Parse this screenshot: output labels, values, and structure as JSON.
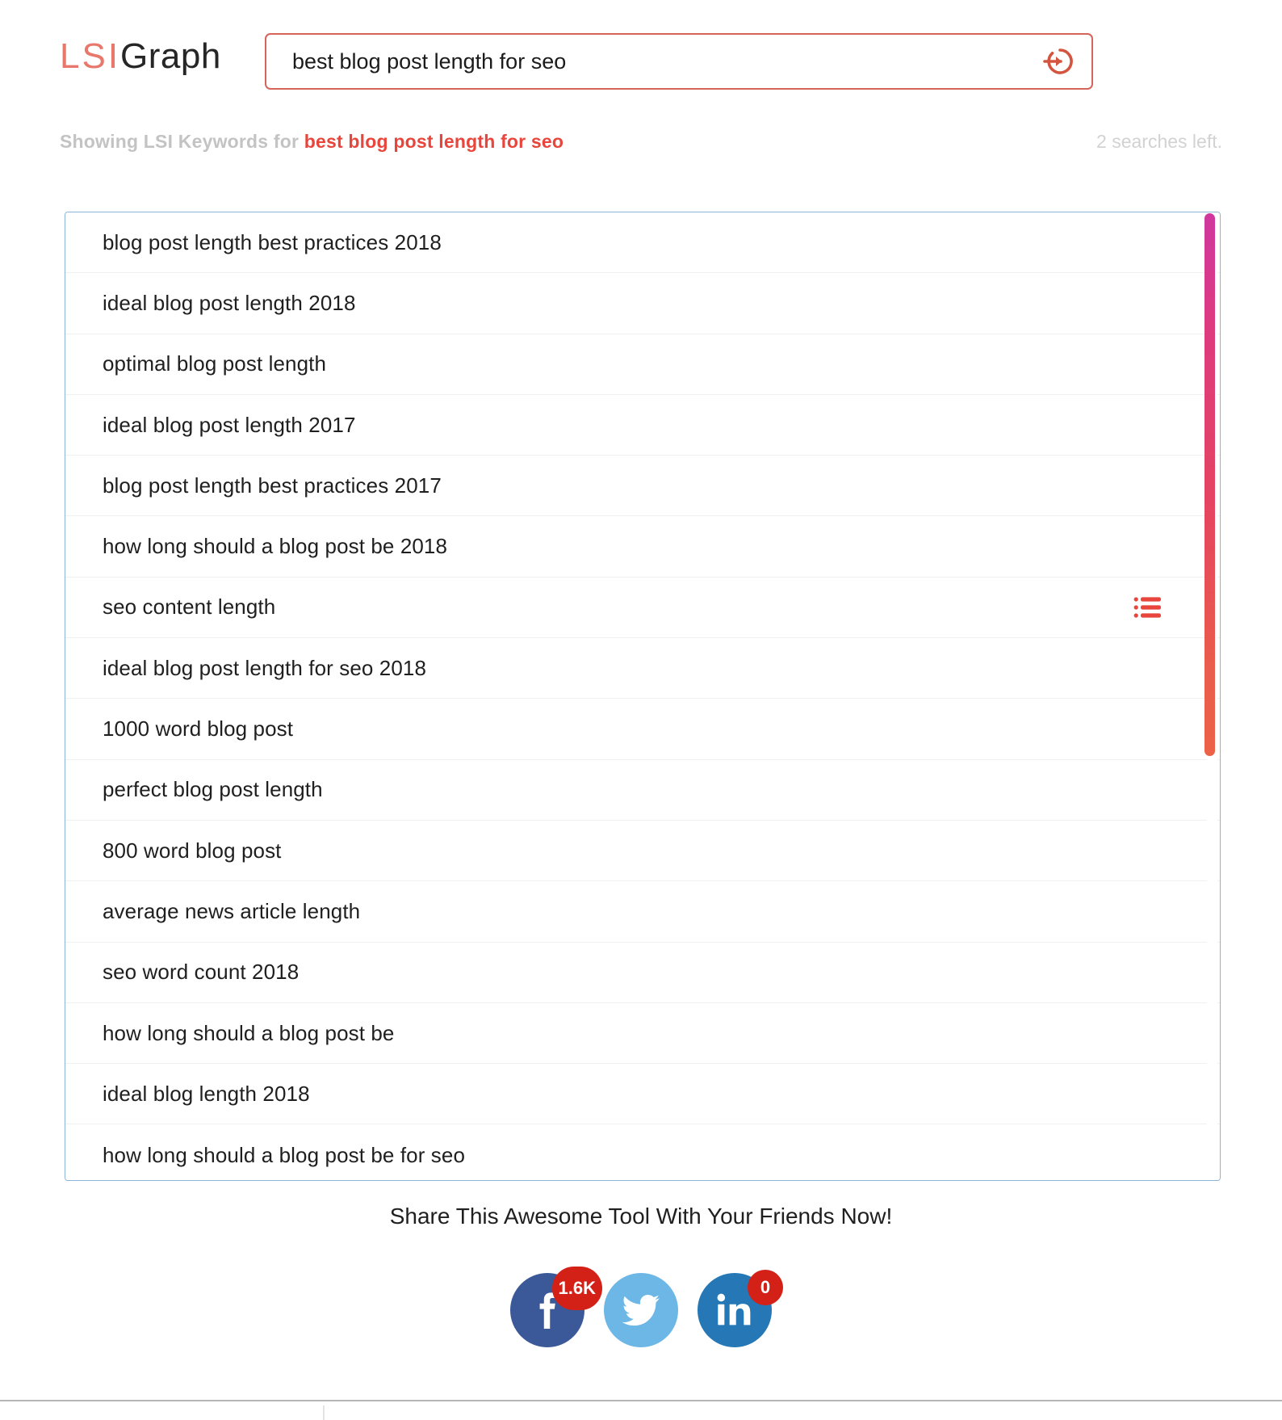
{
  "brand": {
    "logo_primary": "LSI",
    "logo_secondary": "Graph"
  },
  "search": {
    "value": "best blog post length for seo",
    "placeholder": "Enter your keyword",
    "submit_icon": "arrow-right-circle-icon",
    "border_color": "#d3655a"
  },
  "status": {
    "showing_prefix": "Showing LSI Keywords for",
    "showing_term": "best blog post length for seo",
    "searches_left": "2 searches left.",
    "prefix_color": "#c3c3c3",
    "term_color": "#e8453c"
  },
  "keywords": {
    "items": [
      {
        "label": "blog post length best practices 2018",
        "has_action": false
      },
      {
        "label": "ideal blog post length 2018",
        "has_action": false
      },
      {
        "label": "optimal blog post length",
        "has_action": false
      },
      {
        "label": "ideal blog post length 2017",
        "has_action": false
      },
      {
        "label": "blog post length best practices 2017",
        "has_action": false
      },
      {
        "label": "how long should a blog post be 2018",
        "has_action": false
      },
      {
        "label": "seo content length",
        "has_action": true
      },
      {
        "label": "ideal blog post length for seo 2018",
        "has_action": false
      },
      {
        "label": "1000 word blog post",
        "has_action": false
      },
      {
        "label": "perfect blog post length",
        "has_action": false
      },
      {
        "label": "800 word blog post",
        "has_action": false
      },
      {
        "label": "average news article length",
        "has_action": false
      },
      {
        "label": "seo word count 2018",
        "has_action": false
      },
      {
        "label": "how long should a blog post be",
        "has_action": false
      },
      {
        "label": "ideal blog length 2018",
        "has_action": false
      },
      {
        "label": "how long should a blog post be for seo",
        "has_action": false
      }
    ],
    "action_icon": "list-lines-icon",
    "action_icon_color": "#e8453c",
    "panel_border_color": "#8bb4d8",
    "scrollbar_gradient_top": "#d0389f",
    "scrollbar_gradient_bottom": "#ec6247"
  },
  "share": {
    "title": "Share This Awesome Tool With Your Friends Now!",
    "networks": [
      {
        "name": "facebook",
        "icon": "facebook-icon",
        "count": "1.6K",
        "color": "#3b5998",
        "badge_color": "#d32118"
      },
      {
        "name": "twitter",
        "icon": "twitter-icon",
        "count": "",
        "color": "#6cb7e6",
        "badge_color": ""
      },
      {
        "name": "linkedin",
        "icon": "linkedin-icon",
        "count": "0",
        "color": "#2578b5",
        "badge_color": "#d32118"
      }
    ]
  }
}
